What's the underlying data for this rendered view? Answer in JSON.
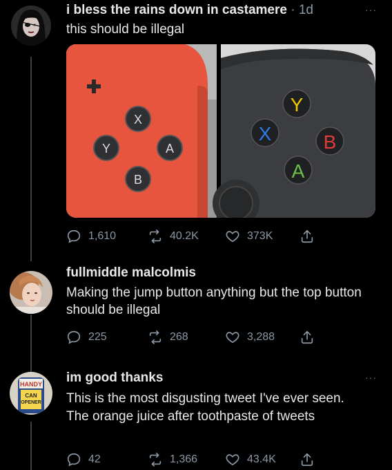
{
  "tweets": [
    {
      "name": "i bless the rains down in castamere",
      "time": "· 1d",
      "text": "this should be illegal",
      "replies": "1,610",
      "retweets": "40.2K",
      "likes": "373K"
    },
    {
      "name": "fullmiddle malcolmis",
      "text": "Making the jump button anything but the top button should be illegal",
      "replies": "225",
      "retweets": "268",
      "likes": "3,288"
    },
    {
      "name": "im good thanks",
      "text": "This is the most disgusting tweet I've ever seen. The orange juice after toothpaste of tweets",
      "replies": "42",
      "retweets": "1,366",
      "likes": "43.4K"
    }
  ],
  "media": {
    "switch_buttons": {
      "top": "X",
      "left": "Y",
      "right": "A",
      "bottom": "B"
    },
    "xbox_buttons": {
      "top": "Y",
      "left": "X",
      "right": "B",
      "bottom": "A"
    }
  },
  "avatar3_label": {
    "line1": "HANDY",
    "line2": "CAN",
    "line3": "OPENER"
  },
  "more_icon": "···",
  "colors": {
    "background": "#000000",
    "muted": "#8b98a5",
    "switch_red": "#e8553f",
    "xbox_gray": "#3b3d40",
    "xbox_y": "#f2c500",
    "xbox_x": "#2e7ae8",
    "xbox_b": "#e03a3a",
    "xbox_a": "#6cc04a"
  }
}
